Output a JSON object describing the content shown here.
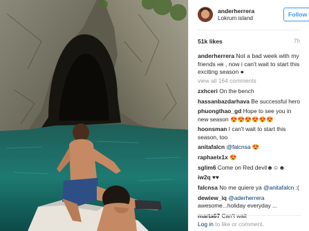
{
  "post": {
    "username": "anderherrera",
    "location": "Lokrum island",
    "follow_label": "Follow",
    "likes": "51k likes",
    "time_ago": "7h",
    "caption_user": "anderherrera",
    "caption_text": "Not a bad week with my friends ʜʀ , now i can't wait to start this exciting season ●",
    "view_all": "view all 164 comments"
  },
  "comments": [
    {
      "user": "zxhceri",
      "text": "On the bench"
    },
    {
      "user": "hassanbazdarhava",
      "text": "Be successful hero"
    },
    {
      "user": "phuongthao_gd",
      "text": "Hope to see you in new season 😍😍😍😍😍😍"
    },
    {
      "user": "hoonsman",
      "text": "I can't wait to start this season, too"
    },
    {
      "user": "anitafalcn",
      "mention": "@falcnsa",
      "text": "😍"
    },
    {
      "user": "raphaelx1x",
      "text": "😍"
    },
    {
      "user": "sglim6",
      "text": "Come on Red devil☻☺☻"
    },
    {
      "user": "iw2q",
      "text": "♥♥"
    },
    {
      "user": "falcnsa",
      "text": "No me quiere ya",
      "mention": "@anitafalcn",
      "text_after": " :("
    },
    {
      "user": "dewiew_iq",
      "mention": "@aderherrera",
      "text": "awesome...holiday everyday ..."
    },
    {
      "user": "marta67",
      "text": "Can't wait"
    }
  ],
  "footer": {
    "login": "Log in",
    "rest": " to like or comment."
  },
  "colors": {
    "accent": "#3897f0",
    "link": "#003569",
    "muted": "#999999",
    "sea": "#1f6f6a"
  },
  "icons": {
    "avatar": "profile-photo",
    "photo": "boat-cave-photo"
  }
}
